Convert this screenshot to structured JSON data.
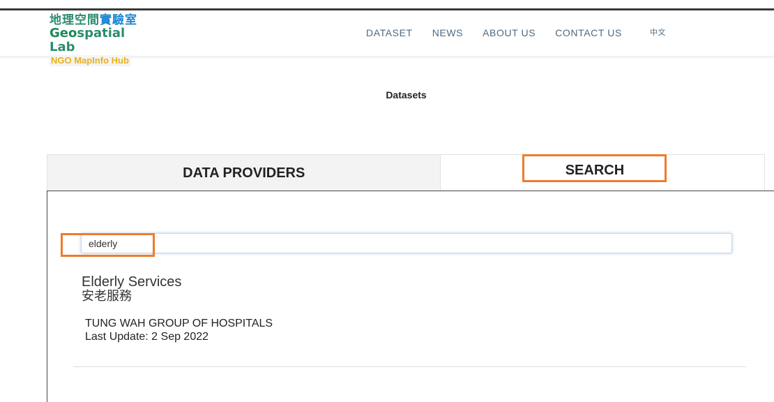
{
  "logo": {
    "chinese_main": "地理空間",
    "chinese_tail": "實驗室",
    "english_geo": "Geo",
    "english_rest": "spatial Lab",
    "hub": "NGO MapInfo Hub"
  },
  "nav": {
    "items": [
      {
        "label": "DATASET"
      },
      {
        "label": "NEWS"
      },
      {
        "label": "ABOUT US"
      },
      {
        "label": "CONTACT US"
      }
    ],
    "language": "中文"
  },
  "page_title": "Datasets",
  "tabs": {
    "providers_label": "DATA PROVIDERS",
    "search_label": "SEARCH",
    "active": "SEARCH"
  },
  "search": {
    "value": "elderly",
    "placeholder": ""
  },
  "results": [
    {
      "title_en": "Elderly Services",
      "title_cn": "安老服務",
      "organization": "TUNG WAH GROUP OF HOSPITALS",
      "last_update": "Last Update: 2 Sep 2022"
    }
  ],
  "colors": {
    "highlight": "#ee7b2c",
    "nav_text": "#4d6a82",
    "logo_green": "#2b8c6e",
    "logo_yellow": "#e8b21b"
  }
}
